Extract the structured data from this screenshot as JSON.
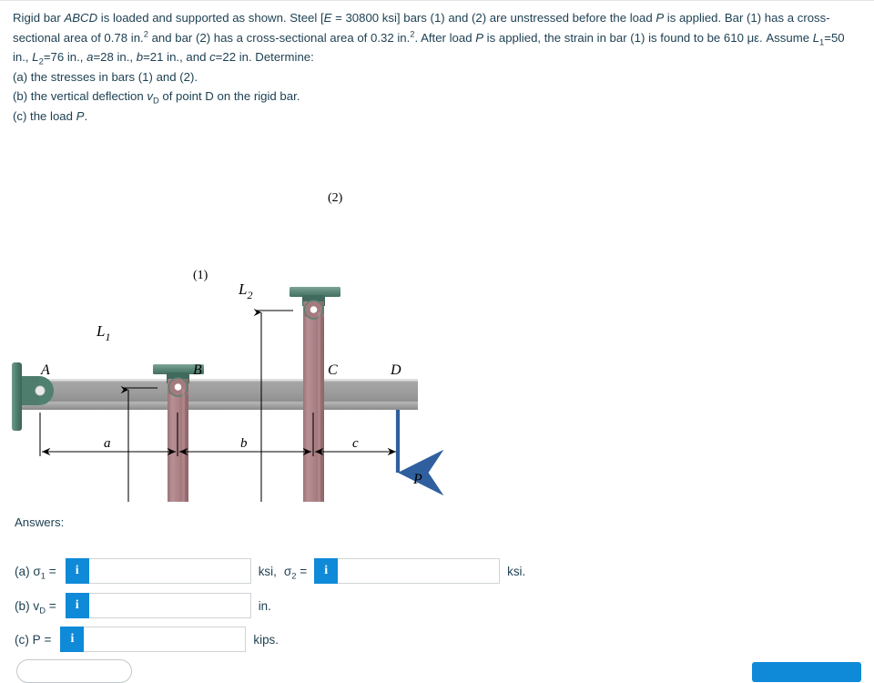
{
  "problem": {
    "line1_a": "Rigid bar ",
    "line1_b": "ABCD",
    "line1_c": " is loaded and supported as shown. Steel [",
    "line1_d": "E",
    "line1_e": " = 30800 ksi] bars (1) and (2) are unstressed before the load ",
    "line1_f": "P",
    "line1_g": " is applied. Bar (1) has a cross-sectional area of 0.78 in.",
    "line1_h": "2",
    "line1_i": " and bar (2) has a cross-sectional area of 0.32 in.",
    "line1_j": "2",
    "line1_k": ". After load ",
    "line1_l": "P",
    "line1_m": " is applied, the strain in bar (1) is found to be 610 με. Assume ",
    "line1_n": "L",
    "line1_o": "1",
    "line1_p": "=50 in., ",
    "line1_q": "L",
    "line1_r": "2",
    "line1_s": "=76 in., ",
    "line1_t": "a",
    "line1_u": "=28 in., ",
    "line1_v": "b",
    "line1_w": "=21 in., and ",
    "line1_x": "c",
    "line1_y": "=22 in. Determine:",
    "part_a": "(a) the stresses in bars (1) and (2).",
    "part_b_pre": "(b) the vertical deflection ",
    "part_b_v": "v",
    "part_b_sub": "D",
    "part_b_post": " of point D on the rigid bar.",
    "part_c_pre": "(c) the load ",
    "part_c_p": "P",
    "part_c_post": "."
  },
  "figure": {
    "labels": {
      "A": "A",
      "B": "B",
      "C": "C",
      "D": "D",
      "bar1": "(1)",
      "bar2": "(2)",
      "L1": "L",
      "L1sub": "1",
      "L2": "L",
      "L2sub": "2",
      "a": "a",
      "b": "b",
      "c": "c",
      "P": "P"
    },
    "colors": {
      "bar_fill": "#ac8386",
      "bar_edge": "#8d6669",
      "support_green": "#5e8a7c",
      "support_green_dark": "#3f6a5d",
      "beam_gray": "#9a9a9a",
      "beam_light": "#c6c6c6",
      "load_blue": "#2f5f9e",
      "pin_white": "#ffffff"
    }
  },
  "answers": {
    "heading": "Answers:",
    "rows": [
      {
        "label_pre": "(a) σ",
        "label_sub": "1",
        "label_post": " =",
        "info_glyph": "i",
        "value": "",
        "placeholder": "",
        "unit": "ksi,",
        "second": {
          "label_pre": "σ",
          "label_sub": "2",
          "label_post": " =",
          "info_glyph": "i",
          "value": "",
          "placeholder": "",
          "unit": "ksi."
        }
      },
      {
        "label_pre": "(b) v",
        "label_sub": "D",
        "label_post": " =",
        "info_glyph": "i",
        "value": "",
        "placeholder": "",
        "unit": "in."
      },
      {
        "label_pre": "(c) P",
        "label_sub": "",
        "label_post": " =",
        "info_glyph": "i",
        "value": "",
        "placeholder": "",
        "unit": "kips."
      }
    ]
  },
  "footer": {
    "etextbook_label": "",
    "submit_label": ""
  }
}
